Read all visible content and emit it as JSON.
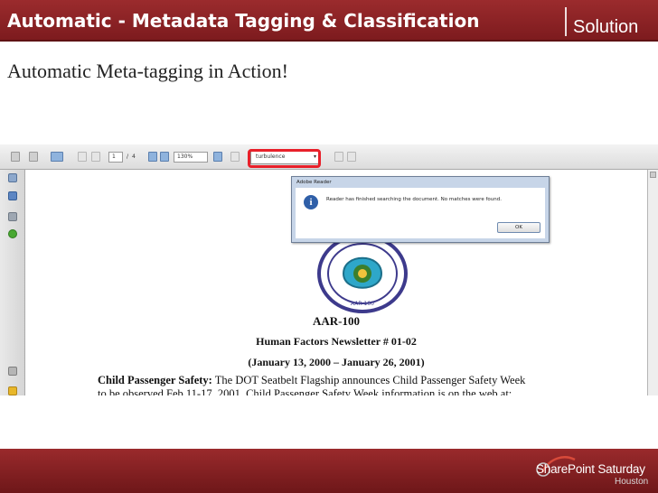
{
  "slide": {
    "title": "Automatic - Metadata Tagging & Classification",
    "section_tag": "Solution",
    "subtitle": "Automatic Meta-tagging in Action!",
    "colors": {
      "title_bar": "#8b2326",
      "highlight": "#e8202a"
    }
  },
  "reader": {
    "toolbar": {
      "page_current": "1",
      "page_separator": "/",
      "page_total": "4",
      "zoom": "130%",
      "find_value": "turbulence"
    },
    "dialog": {
      "title": "Adobe Reader",
      "icon": "info-icon",
      "message": "Reader has finished searching the document. No matches were found.",
      "ok_label": "OK"
    },
    "document": {
      "seal_text": "AAR-100",
      "code": "AAR-100",
      "newsletter": "Human Factors Newsletter # 01-02",
      "dates": "(January 13, 2000 – January 26, 2001)",
      "item_heading": "Child Passenger Safety:",
      "item_line1": "The DOT Seatbelt Flagship announces Child Passenger Safety Week",
      "item_line2": "to be observed Feb 11-17, 2001.  Child Passenger Safety Week information is on the web at:"
    }
  },
  "footer": {
    "brand_name": "SharePoint Saturday",
    "brand_city": "Houston"
  }
}
